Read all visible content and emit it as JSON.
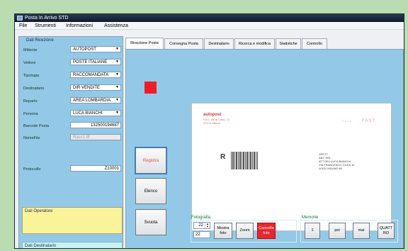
{
  "window": {
    "title": "Posta In Arrivo STD"
  },
  "menu": [
    "File",
    "Strumenti",
    "Informazioni",
    "Assistenza"
  ],
  "ricezione": {
    "title": "Dati Ricezione",
    "fields": [
      {
        "label": "Mittente",
        "value": "AUTOPOST",
        "type": "combo"
      },
      {
        "label": "Vettore",
        "value": "POSTE ITALIANE",
        "type": "combo"
      },
      {
        "label": "Tipologia",
        "value": "RACCOMANDATA",
        "type": "combo"
      },
      {
        "label": "Destinatario",
        "value": "DIR VENDITE",
        "type": "combo"
      },
      {
        "label": "Reparto",
        "value": "AREA LOMBARDIA",
        "type": "combo"
      },
      {
        "label": "Persona",
        "value": "LUCA BIANCHI",
        "type": "combo"
      },
      {
        "label": "Barcode Posta",
        "value": "132500194687",
        "type": "text"
      },
      {
        "label": "NomeFile",
        "value": "Racc1.tif",
        "type": "disabled"
      },
      {
        "label": "Protocollo",
        "value": "Z10001",
        "type": "text"
      }
    ]
  },
  "operatore": {
    "title": "Dati Operatore"
  },
  "destinatario": {
    "title": "Dati Destinatario"
  },
  "tabs": [
    "Ricezione Posta",
    "Consegna Posta",
    "Destinatario",
    "Ricerca e modifica",
    "Statistiche",
    "Controllo"
  ],
  "status_color": "#ee1c25",
  "actions": {
    "registra": "Registra",
    "elenco": "Elenco",
    "svuota": "Svuota"
  },
  "envelope": {
    "logo": "autopost",
    "sender_lines": [
      "Via L. de la Casa, 13",
      "20100 Milano"
    ],
    "stamp_small": "Italia",
    "stamp": "FAST",
    "r_mark": "R",
    "recipient_lines": [
      "SPETT",
      "ABC SRL",
      "ATT DEL LUCA BIANCHI",
      "VIA FRANCESCO CILEA 12",
      "20151 MILANO MI"
    ]
  },
  "fotografia": {
    "label": "Fotografia",
    "spin_value": "22",
    "text_value": "22",
    "mostra": "Mostra foto",
    "zoom": "Zoom",
    "cancella": "Cancella foto"
  },
  "memorie": {
    "label": "Memorie",
    "buttons": [
      "1",
      "poi",
      "mai",
      "QUATTRO"
    ]
  }
}
